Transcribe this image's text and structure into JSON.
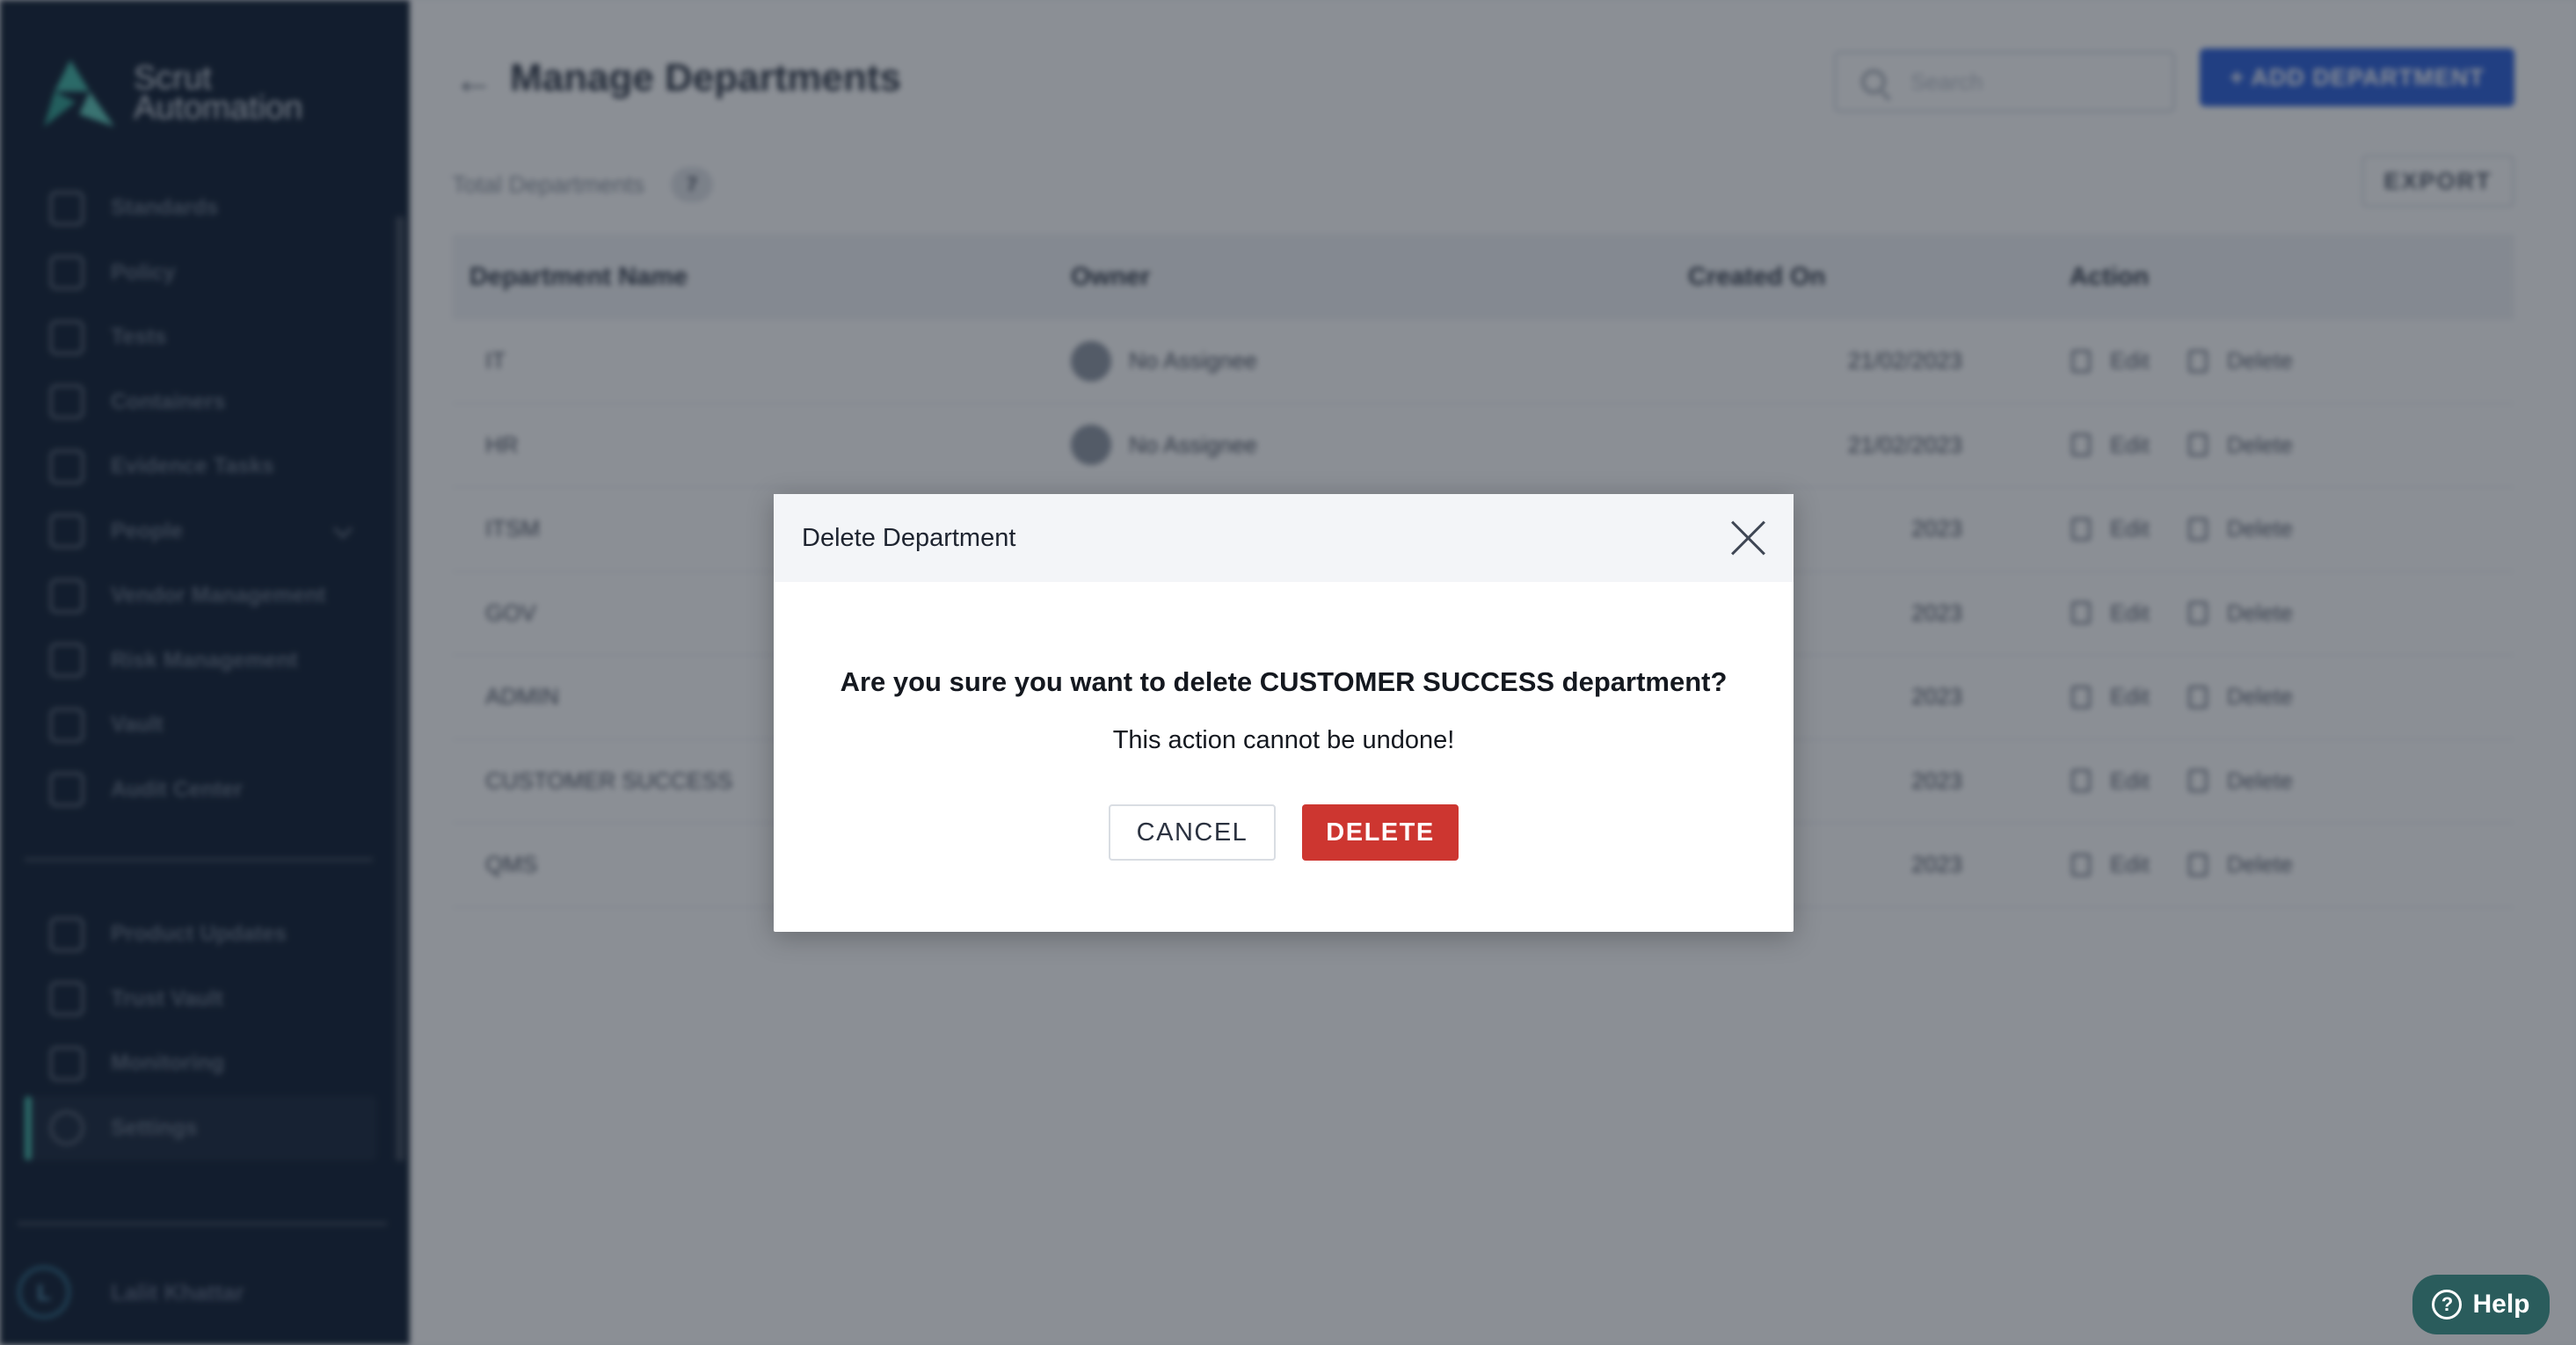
{
  "app": {
    "logo_line1": "Scrut",
    "logo_line2": "Automation"
  },
  "sidebar": {
    "items": [
      {
        "label": "Standards",
        "icon": "standards-icon"
      },
      {
        "label": "Policy",
        "icon": "policy-icon"
      },
      {
        "label": "Tests",
        "icon": "tests-icon"
      },
      {
        "label": "Containers",
        "icon": "containers-icon"
      },
      {
        "label": "Evidence Tasks",
        "icon": "evidence-tasks-icon"
      },
      {
        "label": "People",
        "icon": "people-icon"
      },
      {
        "label": "Vendor Management",
        "icon": "vendor-management-icon"
      },
      {
        "label": "Risk Management",
        "icon": "risk-management-icon"
      },
      {
        "label": "Vault",
        "icon": "vault-icon"
      },
      {
        "label": "Audit Center",
        "icon": "audit-center-icon"
      }
    ],
    "secondary_items": [
      {
        "label": "Product Updates",
        "icon": "megaphone-icon"
      },
      {
        "label": "Trust Vault",
        "icon": "flag-icon"
      },
      {
        "label": "Monitoring",
        "icon": "chart-icon"
      },
      {
        "label": "Settings",
        "icon": "gear-icon"
      }
    ],
    "user": {
      "initial": "L",
      "name": "Lalit Khattar"
    }
  },
  "header": {
    "title": "Manage Departments",
    "search_placeholder": "Search",
    "add_label": "+ ADD DEPARTMENT",
    "total_label": "Total Departments",
    "total_count": "7",
    "export_label": "EXPORT"
  },
  "table": {
    "columns": [
      "Department Name",
      "Owner",
      "Created On",
      "Action"
    ],
    "rows": [
      {
        "name": "IT",
        "owner": "No Assignee",
        "created": "21/02/2023"
      },
      {
        "name": "HR",
        "owner": "No Assignee",
        "created": "21/02/2023"
      },
      {
        "name": "ITSM",
        "owner": "",
        "created": "2023"
      },
      {
        "name": "GOV",
        "owner": "",
        "created": "2023"
      },
      {
        "name": "ADMIN",
        "owner": "",
        "created": "2023"
      },
      {
        "name": "CUSTOMER SUCCESS",
        "owner": "",
        "created": "2023"
      },
      {
        "name": "QMS",
        "owner": "",
        "created": "2023"
      }
    ],
    "edit_label": "Edit",
    "delete_label": "Delete"
  },
  "modal": {
    "title": "Delete Department",
    "question": "Are you sure you want to delete CUSTOMER SUCCESS department?",
    "note": "This action cannot be undone!",
    "cancel_label": "CANCEL",
    "delete_label": "DELETE"
  },
  "help": {
    "label": "Help"
  },
  "colors": {
    "sidebar_bg": "#0d1b30",
    "accent": "#3fb4a4",
    "primary": "#2a5ed9",
    "danger": "#cd3630",
    "help_bg": "#2a5c5c"
  }
}
